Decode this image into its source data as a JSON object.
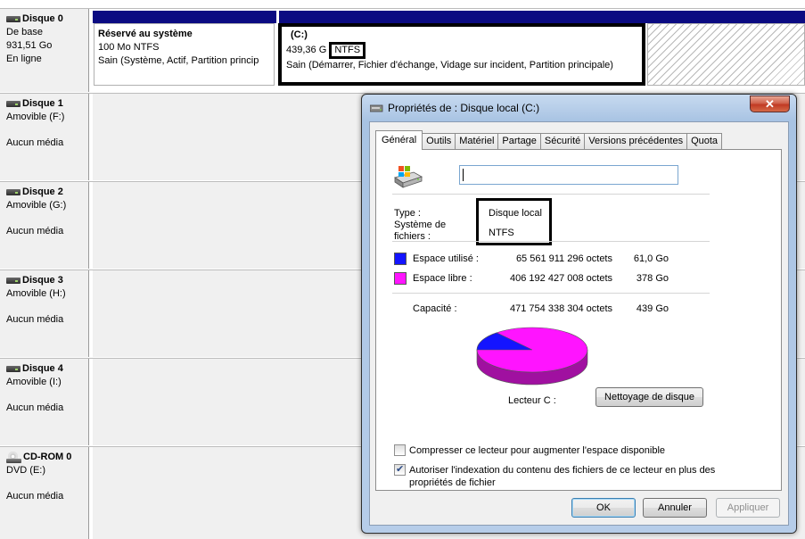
{
  "disks": [
    {
      "name": "Disque 0",
      "icon": "hdd-icon",
      "type": "De base",
      "size": "931,51 Go",
      "status": "En ligne"
    },
    {
      "name": "Disque 1",
      "icon": "hdd-icon",
      "type": "Amovible (F:)",
      "status": "Aucun média"
    },
    {
      "name": "Disque 2",
      "icon": "hdd-icon",
      "type": "Amovible (G:)",
      "status": "Aucun média"
    },
    {
      "name": "Disque 3",
      "icon": "hdd-icon",
      "type": "Amovible (H:)",
      "status": "Aucun média"
    },
    {
      "name": "Disque 4",
      "icon": "hdd-icon",
      "type": "Amovible (I:)",
      "status": "Aucun média"
    },
    {
      "name": "CD-ROM 0",
      "icon": "cd-icon",
      "type": "DVD (E:)",
      "status": "Aucun média"
    }
  ],
  "partitions": {
    "reserved": {
      "title": "Réservé au système",
      "size": "100 Mo NTFS",
      "status": "Sain (Système, Actif, Partition princip"
    },
    "c": {
      "title": "(C:)",
      "size": "439,36 G",
      "fs": "NTFS",
      "status": "Sain (Démarrer, Fichier d'échange, Vidage sur incident, Partition principale)"
    }
  },
  "colors": {
    "partition_bar": "#0b0b82",
    "used": "#1414ff",
    "free": "#ff14ff",
    "used_dark": "#0a0a8a",
    "free_dark": "#a010a0"
  },
  "dialog": {
    "title": "Propriétés de : Disque local (C:)",
    "close_label": "✕",
    "tabs": [
      "Général",
      "Outils",
      "Matériel",
      "Partage",
      "Sécurité",
      "Versions précédentes",
      "Quota"
    ],
    "active_tab": "Général",
    "name_value": "",
    "type_label": "Type :",
    "type_value": "Disque local",
    "fs_label_1": "Système de",
    "fs_label_2": "fichiers :",
    "fs_value": "NTFS",
    "used_label": "Espace utilisé :",
    "used_bytes": "65 561 911 296 octets",
    "used_size": "61,0 Go",
    "free_label": "Espace libre :",
    "free_bytes": "406 192 427 008 octets",
    "free_size": "378 Go",
    "capacity_label": "Capacité :",
    "capacity_bytes": "471 754 338 304 octets",
    "capacity_size": "439 Go",
    "used_fraction": 0.139,
    "drive_label": "Lecteur C :",
    "cleanup_button": "Nettoyage de disque",
    "compress_label": "Compresser ce lecteur pour augmenter l'espace disponible",
    "compress_checked": false,
    "index_label_1": "Autoriser l'indexation du contenu des fichiers de ce lecteur en plus des",
    "index_label_2": "propriétés de fichier",
    "index_checked": true,
    "ok_button": "OK",
    "cancel_button": "Annuler",
    "apply_button": "Appliquer"
  }
}
